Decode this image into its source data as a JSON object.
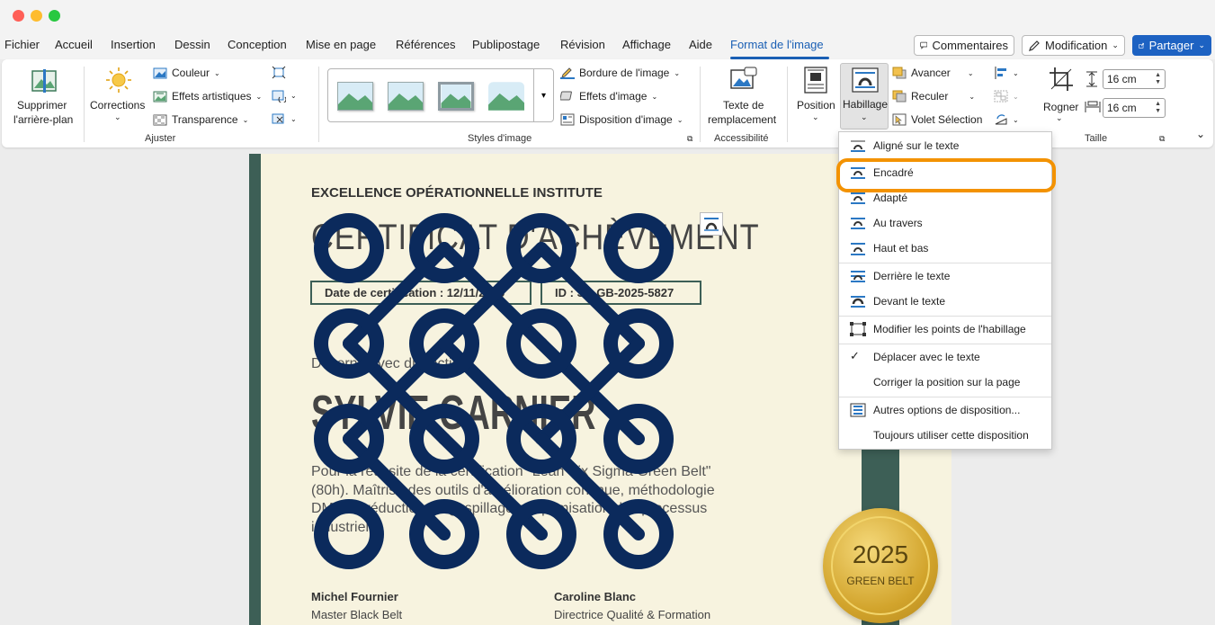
{
  "menu": {
    "tabs": [
      "Fichier",
      "Accueil",
      "Insertion",
      "Dessin",
      "Conception",
      "Mise en page",
      "Références",
      "Publipostage",
      "Révision",
      "Affichage",
      "Aide",
      "Format de l'image"
    ],
    "active_tab": "Format de l'image",
    "comments_label": "Commentaires",
    "modification_label": "Modification",
    "share_label": "Partager"
  },
  "ribbon": {
    "remove_bg_line1": "Supprimer",
    "remove_bg_line2": "l'arrière-plan",
    "corrections": "Corrections",
    "couleur": "Couleur",
    "effets_artistiques": "Effets artistiques",
    "transparence": "Transparence",
    "group_ajuster": "Ajuster",
    "bordure": "Bordure de l'image",
    "effets_image": "Effets d'image",
    "disposition_image": "Disposition d'image",
    "group_styles": "Styles d'image",
    "alt_text_line1": "Texte de",
    "alt_text_line2": "remplacement",
    "group_accessibilite": "Accessibilité",
    "position": "Position",
    "habillage": "Habillage",
    "avancer": "Avancer",
    "reculer": "Reculer",
    "volet_selection": "Volet Sélection",
    "rogner": "Rogner",
    "height_value": "16 cm",
    "width_value": "16 cm",
    "group_taille": "Taille"
  },
  "document": {
    "institute": "EXCELLENCE OPÉRATIONNELLE INSTITUTE",
    "title": "CERTIFICAT D'ACHÈVEMENT",
    "date_box": "Date de certification : 12/11/2025",
    "id_box": "ID : SS-GB-2025-5827",
    "awarded": "Décerné avec distinction",
    "name": "SYLVIE GARNIER",
    "para_line1": "Pour la réussite de la certification \"Lean Six Sigma Green Belt\"",
    "para_line2": "(80h). Maîtrise des outils d'amélioration continue, méthodologie",
    "para_line3": "DMAIC, réduction du gaspillage et optimisation des processus",
    "para_line4": "industriels.",
    "sig1_name": "Michel Fournier",
    "sig1_role": "Master Black Belt",
    "sig2_name": "Caroline Blanc",
    "sig2_role": "Directrice Qualité & Formation",
    "seal_year": "2025",
    "seal_text": "GREEN BELT"
  },
  "wrap_menu": {
    "items": [
      "Aligné sur le texte",
      "Encadré",
      "Adapté",
      "Au travers",
      "Haut et bas",
      "Derrière le texte",
      "Devant le texte",
      "Modifier les points de l'habillage",
      "Déplacer avec le texte",
      "Corriger la position sur la page",
      "Autres options de disposition...",
      "Toujours utiliser cette disposition"
    ],
    "highlighted": "Encadré"
  },
  "colors": {
    "accent_blue": "#1a5fb4",
    "highlight_orange": "#f39200",
    "certificate_green": "#3d5f56",
    "pattern_navy": "#0b2a5c",
    "seal_gold": "#d2a42c"
  }
}
